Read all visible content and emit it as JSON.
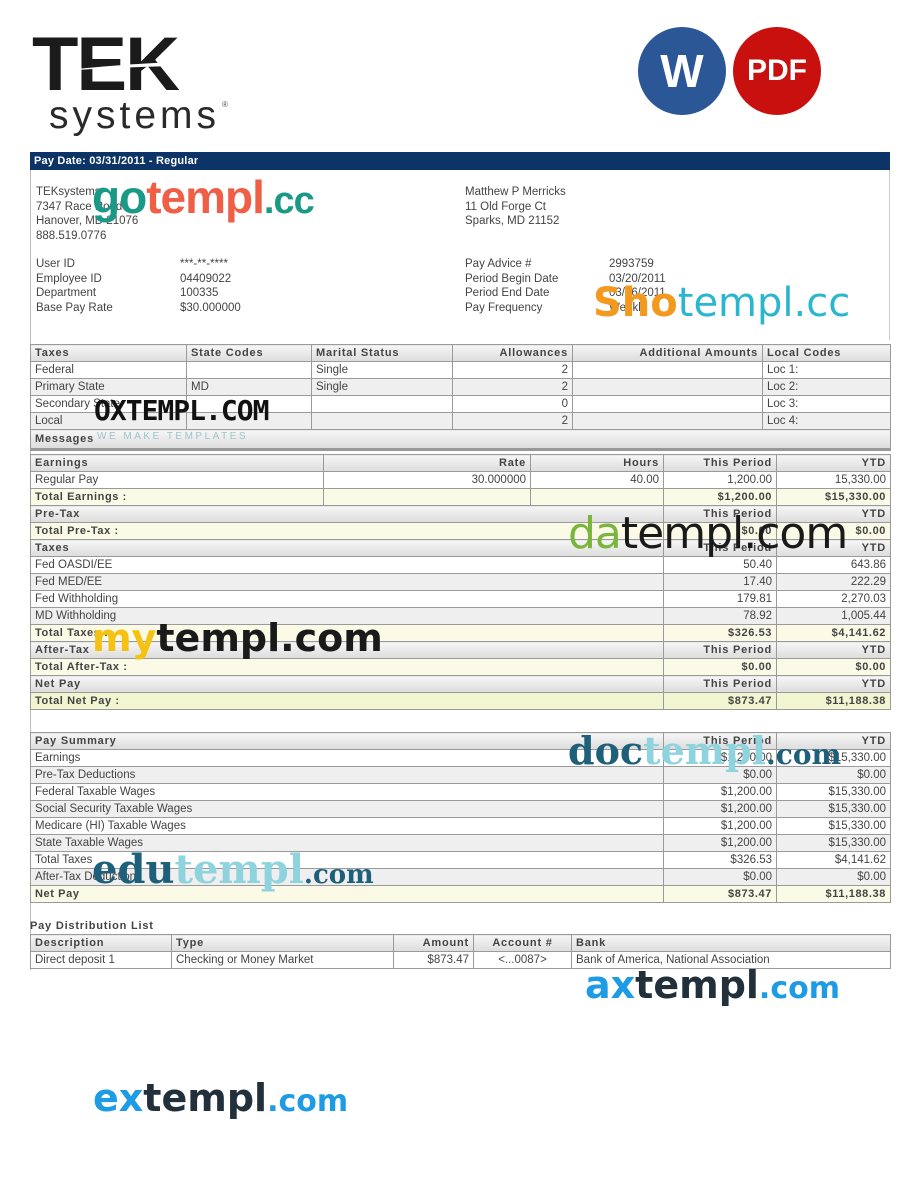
{
  "logo": {
    "brand_top": "TEK",
    "brand_bottom": "systems",
    "registered": "®"
  },
  "badges": {
    "word": "W",
    "pdf": "PDF"
  },
  "colors": {
    "title_bar": "#0c3466",
    "word_badge": "#2b5797",
    "pdf_badge": "#c8100f",
    "total_row": "#fafae6",
    "net_pay_row": "#f1f5d0"
  },
  "title": "Pay Date: 03/31/2011 - Regular",
  "employer": {
    "name": "TEKsystems",
    "street": "7347 Race Road",
    "city": "Hanover, MD 21076",
    "phone": "888.519.0776"
  },
  "employee": {
    "name": "Matthew P Merricks",
    "street": "11 Old Forge Ct",
    "city": "Sparks, MD 21152"
  },
  "employee_info": [
    {
      "label": "User ID",
      "value": "***-**-****"
    },
    {
      "label": "Employee ID",
      "value": "04409022"
    },
    {
      "label": "Department",
      "value": "100335"
    },
    {
      "label": "Base Pay Rate",
      "value": "$30.000000"
    }
  ],
  "pay_info": [
    {
      "label": "Pay Advice #",
      "value": "2993759"
    },
    {
      "label": "Period Begin Date",
      "value": "03/20/2011"
    },
    {
      "label": "Period End Date",
      "value": "03/26/2011"
    },
    {
      "label": "Pay Frequency",
      "value": "Weekly"
    }
  ],
  "tax_table": {
    "headers": [
      "Taxes",
      "State Codes",
      "Marital Status",
      "Allowances",
      "Additional Amounts",
      "Local Codes"
    ],
    "rows": [
      [
        "Federal",
        "",
        "Single",
        "2",
        "",
        "Loc 1:"
      ],
      [
        "Primary State",
        "MD",
        "Single",
        "2",
        "",
        "Loc 2:"
      ],
      [
        "Secondary State",
        "",
        "",
        "0",
        "",
        "Loc 3:"
      ],
      [
        "Local",
        "",
        "",
        "2",
        "",
        "Loc 4:"
      ]
    ],
    "messages_label": "Messages"
  },
  "earnings": {
    "headers": [
      "Earnings",
      "",
      "Rate",
      "Hours",
      "This Period",
      "YTD"
    ],
    "rows": [
      [
        "Regular Pay",
        "",
        "30.000000",
        "40.00",
        "1,200.00",
        "15,330.00"
      ]
    ],
    "total": {
      "label": "Total Earnings :",
      "this_period": "$1,200.00",
      "ytd": "$15,330.00"
    }
  },
  "pretax": {
    "header": "Pre-Tax",
    "col_this": "This Period",
    "col_ytd": "YTD",
    "total": {
      "label": "Total Pre-Tax :",
      "this_period": "$0.00",
      "ytd": "$0.00"
    }
  },
  "taxes": {
    "header": "Taxes",
    "col_this": "This Period",
    "col_ytd": "YTD",
    "rows": [
      [
        "Fed OASDI/EE",
        "50.40",
        "643.86"
      ],
      [
        "Fed MED/EE",
        "17.40",
        "222.29"
      ],
      [
        "Fed Withholding",
        "179.81",
        "2,270.03"
      ],
      [
        "MD Withholding",
        "78.92",
        "1,005.44"
      ]
    ],
    "total": {
      "label": "Total Taxes :",
      "this_period": "$326.53",
      "ytd": "$4,141.62"
    }
  },
  "aftertax": {
    "header": "After-Tax",
    "col_this": "This Period",
    "col_ytd": "YTD",
    "total": {
      "label": "Total After-Tax :",
      "this_period": "$0.00",
      "ytd": "$0.00"
    }
  },
  "netpay": {
    "header": "Net Pay",
    "col_this": "This Period",
    "col_ytd": "YTD",
    "total": {
      "label": "Total Net Pay :",
      "this_period": "$873.47",
      "ytd": "$11,188.38"
    }
  },
  "pay_summary": {
    "header": "Pay Summary",
    "col_this": "This Period",
    "col_ytd": "YTD",
    "rows": [
      [
        "Earnings",
        "$1,200.00",
        "$15,330.00"
      ],
      [
        "Pre-Tax Deductions",
        "$0.00",
        "$0.00"
      ],
      [
        "Federal Taxable Wages",
        "$1,200.00",
        "$15,330.00"
      ],
      [
        "Social Security Taxable Wages",
        "$1,200.00",
        "$15,330.00"
      ],
      [
        "Medicare (HI) Taxable Wages",
        "$1,200.00",
        "$15,330.00"
      ],
      [
        "State Taxable Wages",
        "$1,200.00",
        "$15,330.00"
      ],
      [
        "Total Taxes",
        "$326.53",
        "$4,141.62"
      ],
      [
        "After-Tax Deductions",
        "$0.00",
        "$0.00"
      ]
    ],
    "total": {
      "label": "Net Pay",
      "this_period": "$873.47",
      "ytd": "$11,188.38"
    }
  },
  "distribution": {
    "title": "Pay Distribution List",
    "headers": [
      "Description",
      "Type",
      "Amount",
      "Account #",
      "Bank"
    ],
    "rows": [
      [
        "Direct deposit 1",
        "Checking or Money Market",
        "$873.47",
        "<...0087>",
        "Bank of America, National Association"
      ]
    ]
  },
  "watermarks": {
    "gotempl": {
      "a": "go",
      "b": "templ",
      "c": ".cc"
    },
    "shotempl": {
      "a": "Sho",
      "b": "templ.cc"
    },
    "oxtempl": {
      "a": "OXTEMPL.COM",
      "b": "WE MAKE TEMPLATES"
    },
    "datempl": {
      "a": "da",
      "b": "templ.com"
    },
    "mytempl": {
      "a": "my",
      "b": "templ.com"
    },
    "doctempl": {
      "a": "doc",
      "b": "templ",
      "c": ".com"
    },
    "edutempl": {
      "a": "edu",
      "b": "templ",
      "c": ".com"
    },
    "axtempl": {
      "a": "ax",
      "b": "templ",
      "c": ".com"
    },
    "extempl": {
      "a": "ex",
      "b": "templ",
      "c": ".com"
    }
  }
}
